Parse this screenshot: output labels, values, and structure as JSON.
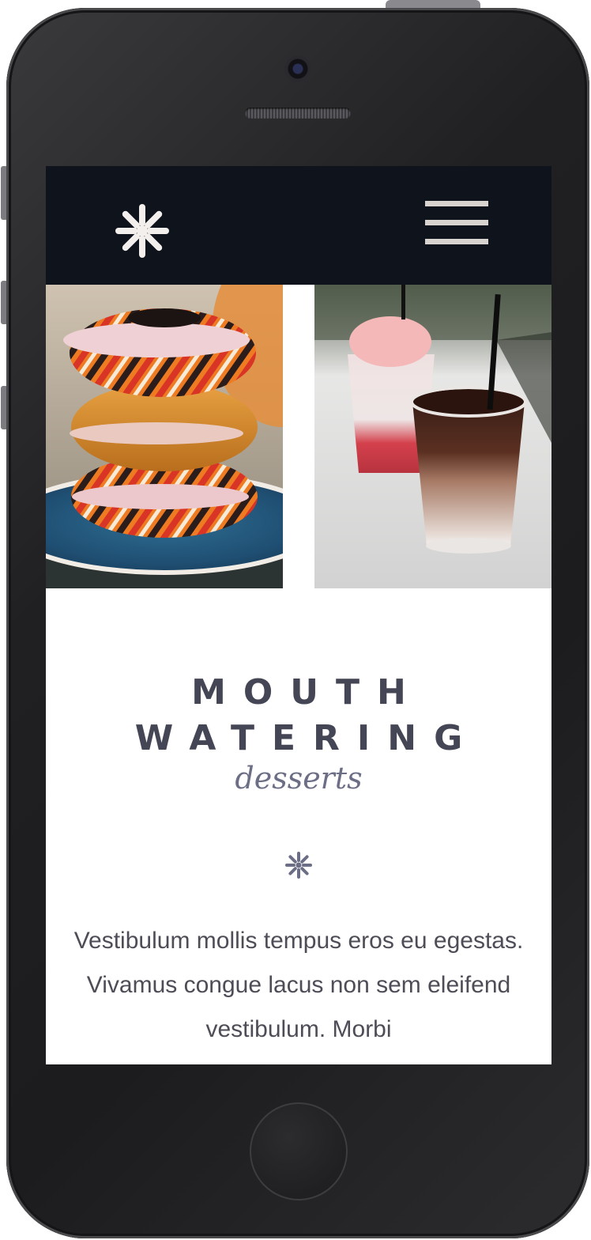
{
  "header": {
    "logo_icon": "asterisk-flower-icon",
    "menu_icon": "hamburger-menu-icon"
  },
  "gallery": {
    "images": [
      {
        "subject": "bagel-stack-photo"
      },
      {
        "subject": "iced-drinks-photo"
      }
    ]
  },
  "hero": {
    "title_line1": "MOUTH",
    "title_line2": "WATERING",
    "subtitle": "desserts",
    "divider_icon": "asterisk-icon",
    "body": "Vestibulum mollis tempus eros eu egestas. Vivamus congue lacus non sem eleifend vestibulum. Morbi"
  },
  "colors": {
    "navbar_bg": "#0f131b",
    "title": "#454655",
    "accent": "#6c6e86",
    "body_text": "#4d4d57"
  }
}
